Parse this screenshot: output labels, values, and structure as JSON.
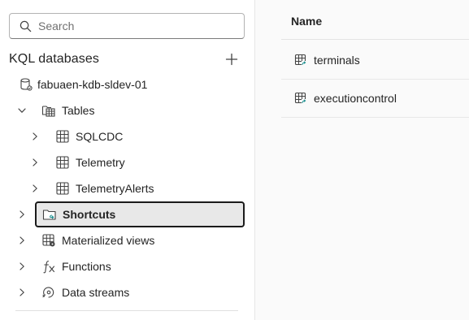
{
  "search": {
    "placeholder": "Search",
    "value": ""
  },
  "section": {
    "title": "KQL databases",
    "add_icon": "add-icon"
  },
  "tree": {
    "database": {
      "label": "fabuaen-kdb-sldev-01",
      "icon": "database-icon"
    },
    "tables": {
      "label": "Tables",
      "icon": "tables-folder-icon",
      "expanded": true,
      "children": [
        {
          "label": "SQLCDC",
          "icon": "table-icon"
        },
        {
          "label": "Telemetry",
          "icon": "table-icon"
        },
        {
          "label": "TelemetryAlerts",
          "icon": "table-icon"
        }
      ]
    },
    "shortcuts": {
      "label": "Shortcuts",
      "icon": "shortcut-folder-icon",
      "selected": true
    },
    "materialized_views": {
      "label": "Materialized views",
      "icon": "materialized-view-icon"
    },
    "functions": {
      "label": "Functions",
      "icon": "function-icon"
    },
    "data_streams": {
      "label": "Data streams",
      "icon": "data-stream-icon"
    }
  },
  "table_list": {
    "column_header": "Name",
    "rows": [
      {
        "label": "terminals",
        "icon": "shortcut-table-icon"
      },
      {
        "label": "executioncontrol",
        "icon": "shortcut-table-icon"
      }
    ]
  },
  "colors": {
    "selected_bg": "#e8e8e8",
    "selected_border": "#1b1b1b",
    "text": "#242424",
    "right_pane_bg": "#fafafa"
  }
}
